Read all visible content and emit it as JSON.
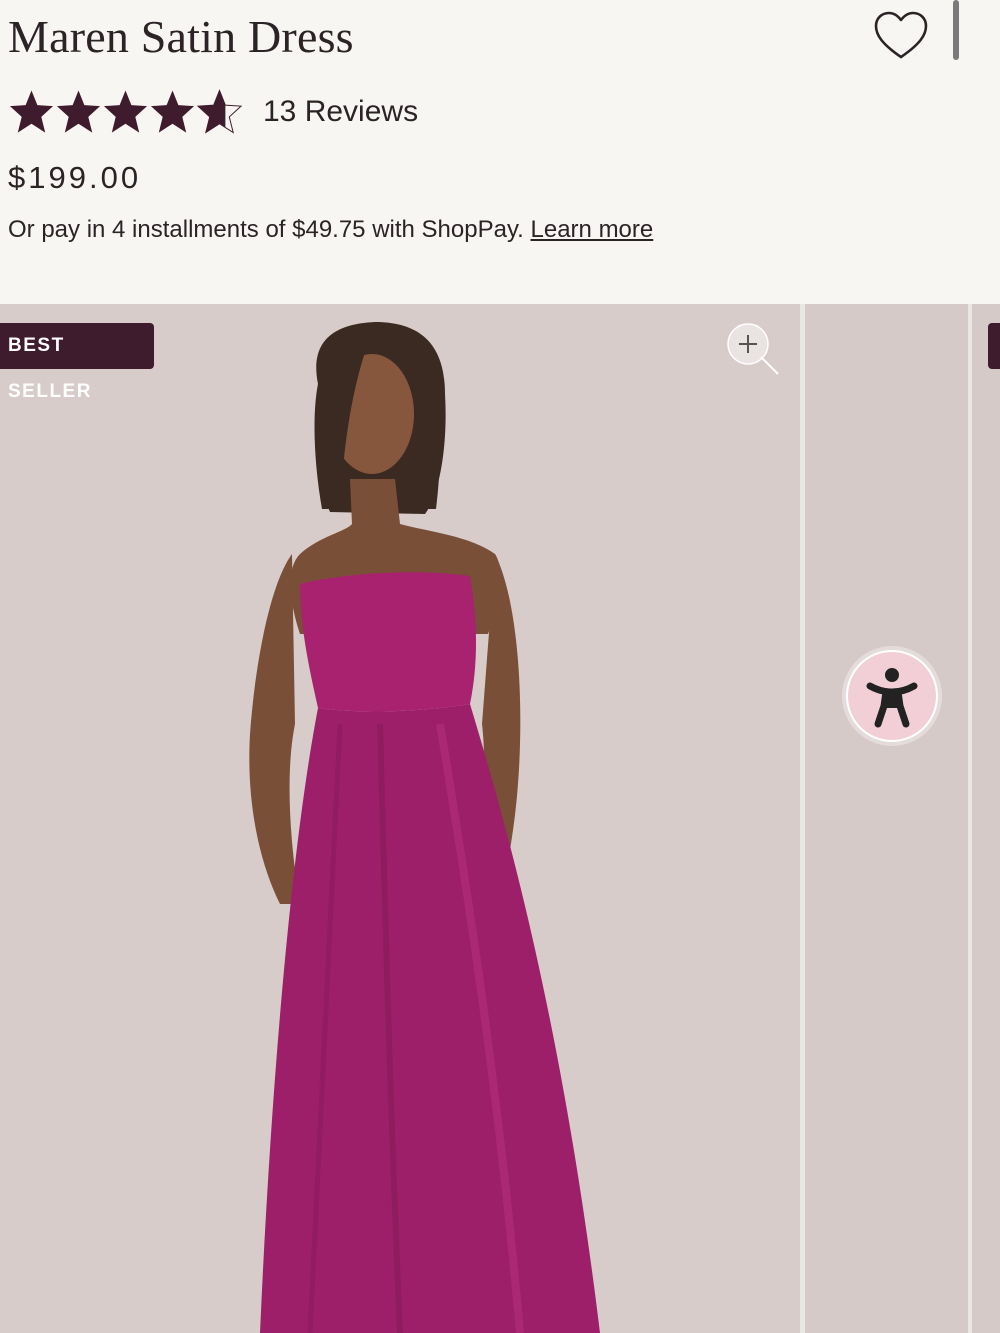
{
  "product": {
    "title": "Maren Satin Dress",
    "rating": 4.5,
    "rating_max": 5,
    "reviews_label": "13 Reviews",
    "price": "$199.00",
    "installments_text": "Or pay in 4 installments of $49.75 with ShopPay.",
    "learn_more": "Learn more"
  },
  "gallery": {
    "badge": "BEST SELLER",
    "image_alt": "Model wearing magenta strapless satin maxi dress"
  },
  "icons": {
    "wishlist": "heart-icon",
    "zoom": "zoom-in-icon",
    "accessibility": "accessibility-icon",
    "star": "star-icon"
  },
  "colors": {
    "brand_dark": "#3e1b2d",
    "dress": "#a8226f",
    "text": "#2b2326",
    "accessibility_bg": "#f2cfd6"
  }
}
